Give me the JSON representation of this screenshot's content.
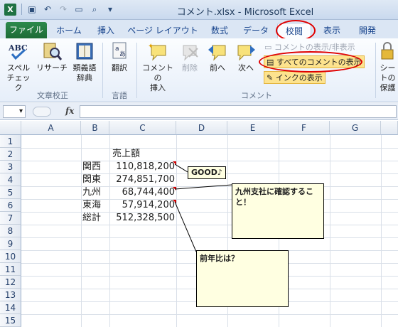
{
  "window": {
    "title": "コメント.xlsx - Microsoft Excel",
    "app_icon": "X"
  },
  "tabs": [
    "ファイル",
    "ホーム",
    "挿入",
    "ページ レイアウト",
    "数式",
    "データ",
    "校閲",
    "表示",
    "開発"
  ],
  "ribbon": {
    "spell": [
      "スペル",
      "チェック"
    ],
    "research": "リサーチ",
    "thesaurus": [
      "類義語",
      "辞典"
    ],
    "translate": "翻訳",
    "new_comment": [
      "コメントの",
      "挿入"
    ],
    "delete": "削除",
    "prev": "前へ",
    "next": "次へ",
    "toggle_comment": "コメントの表示/非表示",
    "show_all": "すべてのコメントの表示",
    "show_ink": "インクの表示",
    "protect": [
      "シートの",
      "保護"
    ],
    "groups": {
      "proofing": "文章校正",
      "language": "言語",
      "comments": "コメント"
    }
  },
  "formula_bar": {
    "fx": "fx",
    "value": ""
  },
  "columns": [
    "A",
    "B",
    "C",
    "D",
    "E",
    "F",
    "G"
  ],
  "rows": [
    "1",
    "2",
    "3",
    "4",
    "5",
    "6",
    "7",
    "8",
    "9",
    "10",
    "11",
    "12",
    "13",
    "14",
    "15"
  ],
  "sheet": {
    "header": "売上額",
    "regions": [
      "関西",
      "関東",
      "九州",
      "東海",
      "総計"
    ],
    "values": [
      "110,818,200",
      "274,851,700",
      "68,744,400",
      "57,914,200",
      "512,328,500"
    ]
  },
  "comments": {
    "c3": "GOOD♪",
    "c5": "九州支社に確認すること！",
    "c6": "前年比は？"
  },
  "colors": {
    "highlight": "#e00000",
    "comment_bg": "#ffffe1",
    "file_tab": "#1f7244"
  }
}
